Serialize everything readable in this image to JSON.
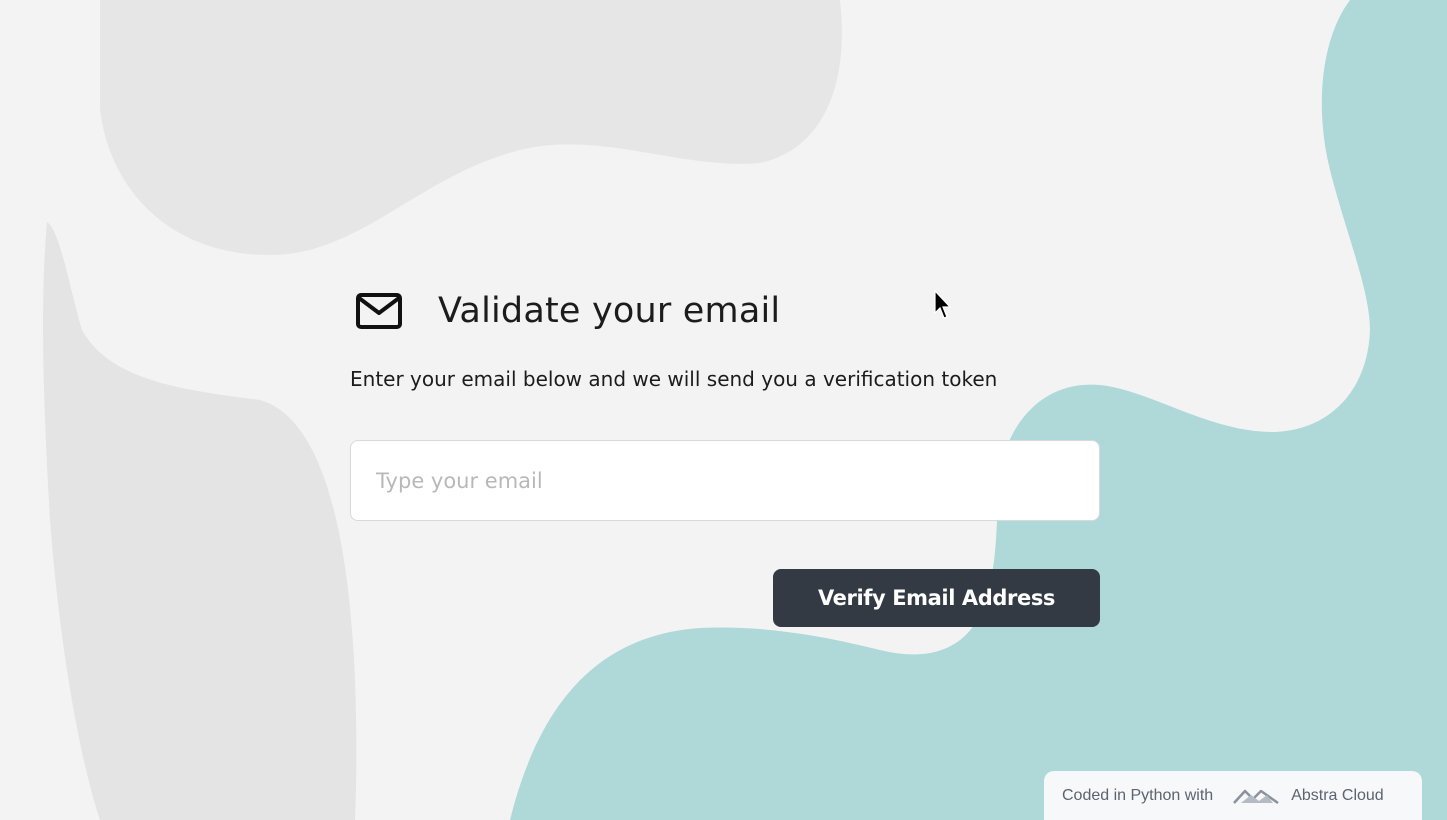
{
  "page": {
    "title": "Validate your email",
    "subtitle": "Enter your email below and we will send you a verification token",
    "icon": "mail-icon"
  },
  "form": {
    "email_placeholder": "Type your email",
    "email_value": "",
    "submit_label": "Verify Email Address"
  },
  "footer": {
    "prefix": "Coded in Python with",
    "brand": "Abstra Cloud",
    "logo_icon": "abstra-logo-icon"
  },
  "colors": {
    "background": "#f3f3f4",
    "teal_accent": "#aed9d8",
    "blob_gray": "#e5e5e6",
    "button": "#333a44",
    "button_text": "#ffffff"
  }
}
